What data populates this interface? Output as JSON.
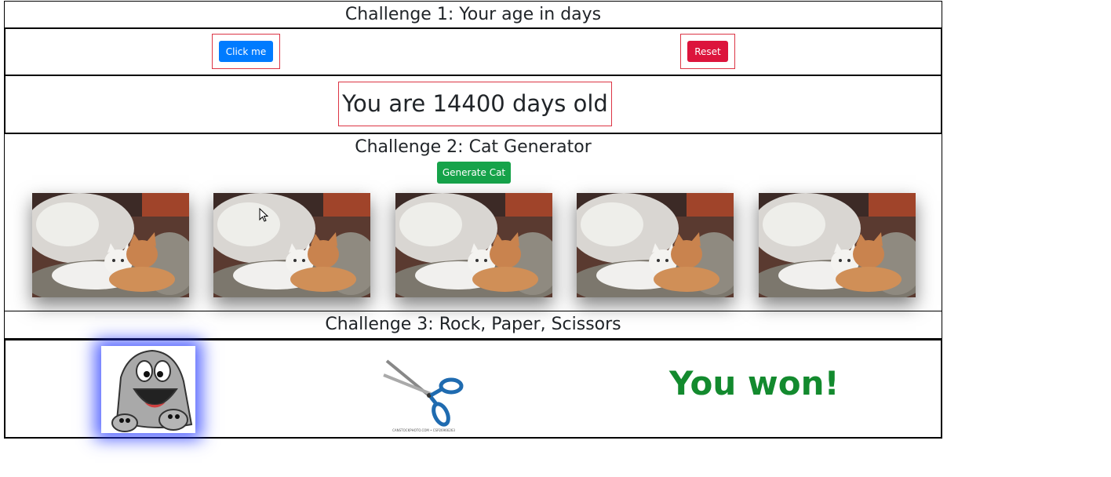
{
  "challenge1": {
    "title": "Challenge 1: Your age in days",
    "click_label": "Click me",
    "reset_label": "Reset",
    "result_text": "You are 14400 days old"
  },
  "challenge2": {
    "title": "Challenge 2: Cat Generator",
    "generate_label": "Generate Cat",
    "cat_count": 5
  },
  "challenge3": {
    "title": "Challenge 3: Rock, Paper, Scissors",
    "human_choice": "rock",
    "bot_choice": "scissors",
    "result_text": "You won!",
    "result_color": "#138a2e",
    "scissors_caption": "CANSTOCKPHOTO.COM • CSP26966263"
  }
}
